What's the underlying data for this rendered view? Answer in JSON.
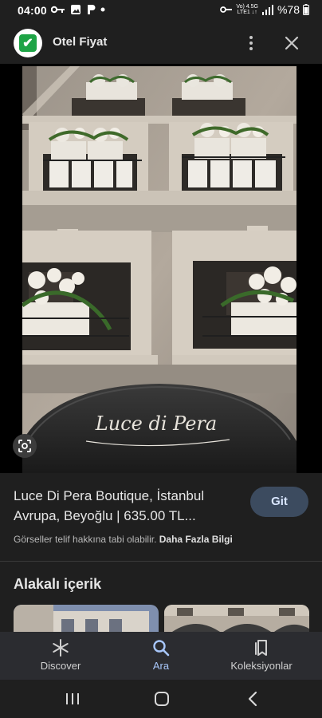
{
  "status_bar": {
    "time": "04:00",
    "network_top": "Vo) 4.5G",
    "network_bottom": "LTE1 ↓↑",
    "battery": "%78",
    "icons": [
      "key-icon",
      "image-icon",
      "p-app-icon",
      "dot-icon",
      "key-icon",
      "signal-icon",
      "battery-icon"
    ]
  },
  "topbar": {
    "title": "Otel Fiyat",
    "logo_icon": "checkmark-icon",
    "more_icon": "more-vert-icon",
    "close_icon": "close-icon"
  },
  "image": {
    "sign_text": "Luce di Pera",
    "lens_icon": "google-lens-icon"
  },
  "result": {
    "title": "Luce Di Pera Boutique, İstanbul Avrupa, Beyoğlu | 635.00 TL...",
    "visit_label": "Git",
    "copyright_text": "Görseller telif hakkına tabi olabilir.",
    "more_info_link": "Daha Fazla Bilgi"
  },
  "related": {
    "heading": "Alakalı içerik"
  },
  "bottom_nav": {
    "items": [
      {
        "label": "Discover",
        "icon": "asterisk-icon"
      },
      {
        "label": "Ara",
        "icon": "search-icon"
      },
      {
        "label": "Koleksiyonlar",
        "icon": "bookmarks-icon"
      }
    ]
  },
  "system_nav": {
    "recents_icon": "recents-icon",
    "home_icon": "home-icon",
    "back_icon": "back-icon"
  },
  "colors": {
    "background": "#1f1f1f",
    "accent": "#a8c7fa",
    "visit_button_bg": "#3c4b5f",
    "nav_bg": "#2b2c30"
  }
}
